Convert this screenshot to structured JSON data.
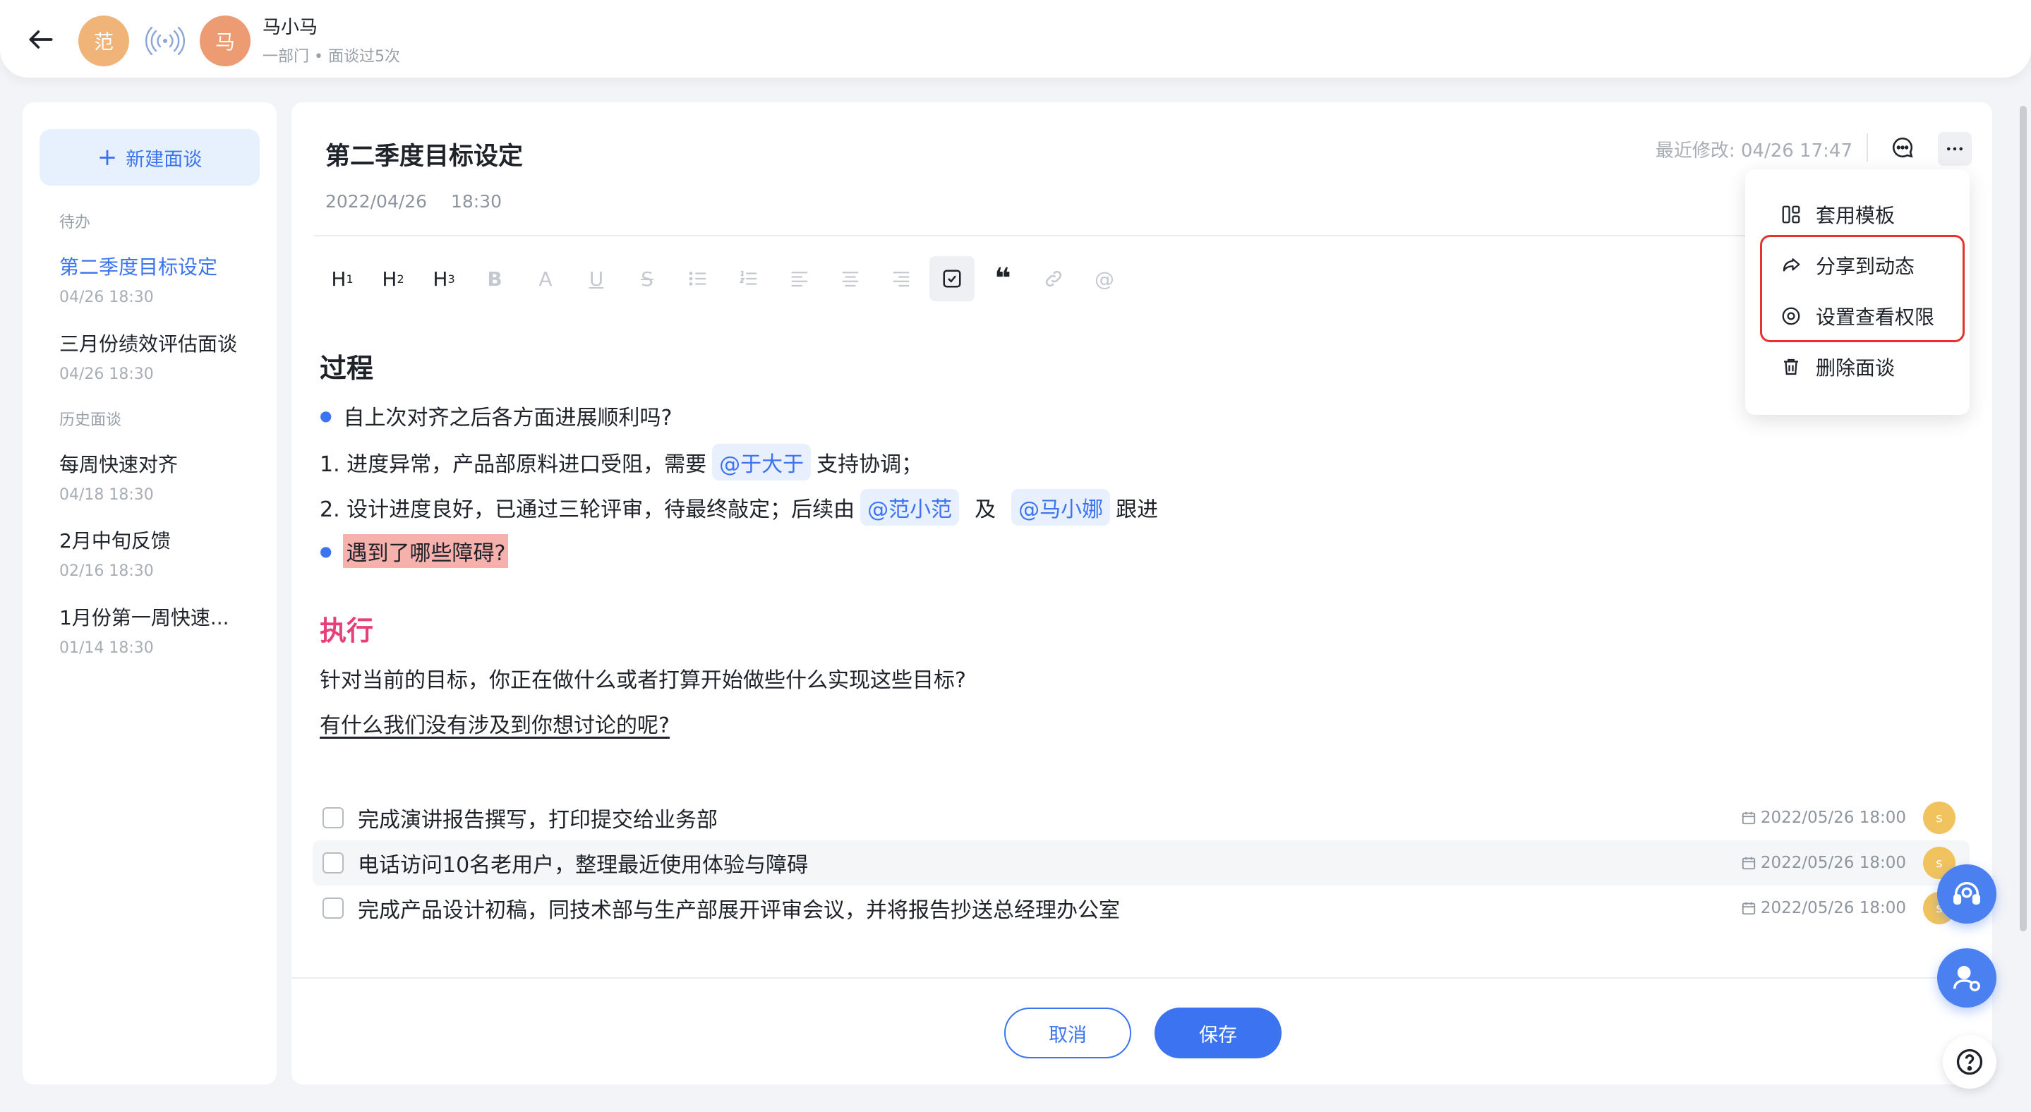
{
  "header": {
    "back_icon": "arrow-left-icon",
    "host_avatar": "范",
    "guest_avatar": "马",
    "guest_name": "马小马",
    "guest_sub": "一部门 • 面谈过5次"
  },
  "sidebar": {
    "new_button": "新建面谈",
    "group_pending": "待办",
    "group_history": "历史面谈",
    "pending": [
      {
        "title": "第二季度目标设定",
        "date": "04/26 18:30",
        "active": true
      },
      {
        "title": "三月份绩效评估面谈",
        "date": "04/26 18:30"
      }
    ],
    "history": [
      {
        "title": "每周快速对齐",
        "date": "04/18 18:30"
      },
      {
        "title": "2月中旬反馈",
        "date": "02/16 18:30"
      },
      {
        "title": "1月份第一周快速...",
        "date": "01/14 18:30"
      }
    ]
  },
  "doc": {
    "title": "第二季度目标设定",
    "date": "2022/04/26",
    "time": "18:30",
    "modified": "最近修改: 04/26 17:47"
  },
  "toolbar": {
    "h1": "H",
    "h2": "H",
    "h3": "H",
    "h1_sub": "1",
    "h2_sub": "2",
    "h3_sub": "3",
    "bold": "B",
    "color": "A",
    "underline": "U",
    "strike": "S",
    "quote": "❝",
    "at": "@"
  },
  "content": {
    "section1": "过程",
    "s1_bullet1": "自上次对齐之后各方面进展顺利吗?",
    "s1_l1_a": "1. 进度异常，产品部原料进口受阻，需要",
    "s1_l1_mention": "@于大于",
    "s1_l1_b": "支持协调；",
    "s1_l2_a": "2. 设计进度良好，已通过三轮评审，待最终敲定；后续由",
    "s1_l2_m1": "@范小范",
    "s1_l2_mid": "及",
    "s1_l2_m2": "@马小娜",
    "s1_l2_b": "跟进",
    "s1_bullet2": "遇到了哪些障碍?",
    "section2": "执行",
    "s2_line1": "针对当前的目标，你正在做什么或者打算开始做些什么实现这些目标?",
    "s2_line2": "有什么我们没有涉及到你想讨论的呢? "
  },
  "tasks": [
    {
      "text": "完成演讲报告撰写，打印提交给业务部",
      "due": "2022/05/26 18:00",
      "assignee": "s"
    },
    {
      "text": "电话访问10名老用户，整理最近使用体验与障碍",
      "due": "2022/05/26 18:00",
      "assignee": "s"
    },
    {
      "text": "完成产品设计初稿，同技术部与生产部展开评审会议，并将报告抄送总经理办公室",
      "due": "2022/05/26 18:00",
      "assignee": "s"
    }
  ],
  "footer": {
    "cancel": "取消",
    "save": "保存"
  },
  "menu": {
    "template": "套用模板",
    "share": "分享到动态",
    "permission": "设置查看权限",
    "delete": "删除面谈"
  },
  "colors": {
    "accent": "#3b73f1",
    "execute_heading": "#e5407a",
    "highlight": "#f7b1ac",
    "annotation_box": "#e5322d"
  }
}
